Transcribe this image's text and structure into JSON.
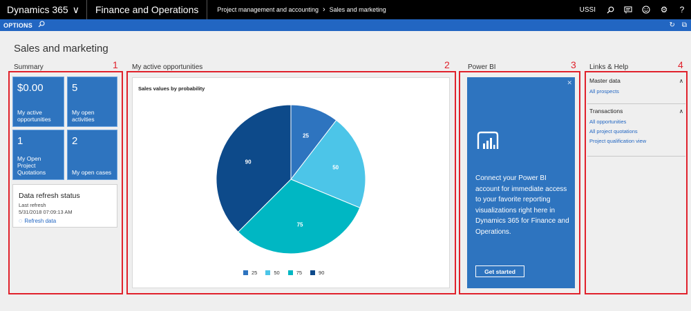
{
  "topbar": {
    "brand": "Dynamics 365",
    "app": "Finance and Operations",
    "breadcrumb": [
      "Project management and accounting",
      "Sales and marketing"
    ],
    "company": "USSI"
  },
  "options": {
    "label": "OPTIONS"
  },
  "page": {
    "title": "Sales and marketing"
  },
  "sections": {
    "summary": "Summary",
    "opportunities": "My active opportunities",
    "powerbi": "Power BI",
    "links": "Links & Help"
  },
  "markers": [
    "1",
    "2",
    "3",
    "4"
  ],
  "tiles": [
    {
      "value": "$0.00",
      "label": "My active opportunities"
    },
    {
      "value": "5",
      "label": "My open activities"
    },
    {
      "value": "1",
      "label": "My Open Project Quotations"
    },
    {
      "value": "2",
      "label": "My open cases"
    }
  ],
  "refresh": {
    "title": "Data refresh status",
    "last_label": "Last refresh",
    "timestamp": "5/31/2018 07:09:13 AM",
    "link": "Refresh data"
  },
  "chart_data": {
    "type": "pie",
    "title": "Sales values by probability",
    "categories": [
      "25",
      "50",
      "75",
      "90"
    ],
    "values": [
      25,
      50,
      75,
      90
    ],
    "colors": [
      "#2e74bf",
      "#4cc5e8",
      "#00b7c3",
      "#0d4a8a"
    ],
    "legend": "bottom"
  },
  "powerbi": {
    "message": "Connect your Power BI account for immediate access to your favorite reporting visualizations right here in Dynamics 365 for Finance and Operations.",
    "button": "Get started"
  },
  "links": {
    "groups": [
      {
        "header": "Master data",
        "items": [
          "All prospects"
        ]
      },
      {
        "header": "Transactions",
        "items": [
          "All opportunities",
          "All project quotations",
          "Project qualification view"
        ]
      }
    ]
  }
}
